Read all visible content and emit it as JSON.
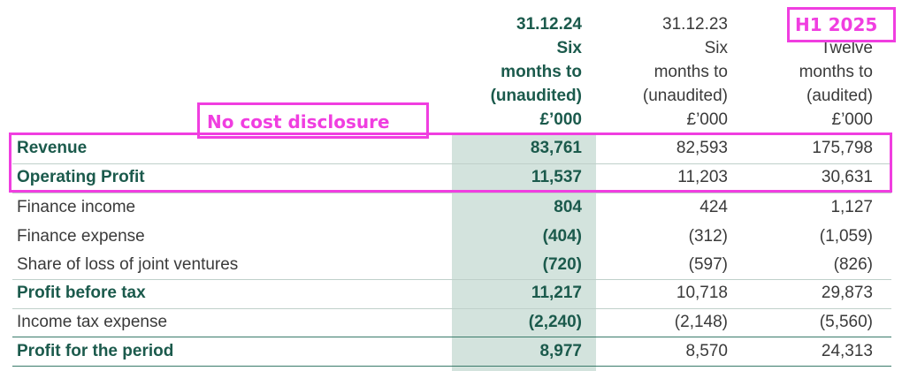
{
  "columns": [
    {
      "line1": "31.12.24",
      "line2": "Six",
      "line3": "months to",
      "line4": "(unaudited)",
      "line5": "£’000"
    },
    {
      "line1": "31.12.23",
      "line2": "Six",
      "line3": "months to",
      "line4": "(unaudited)",
      "line5": "£’000"
    },
    {
      "line1": "",
      "line2": "Twelve",
      "line3": "months to",
      "line4": "(audited)",
      "line5": "£’000"
    }
  ],
  "rows": [
    {
      "label": "Revenue",
      "v1": "83,761",
      "v2": "82,593",
      "v3": "175,798"
    },
    {
      "label": "Operating Profit",
      "v1": "11,537",
      "v2": "11,203",
      "v3": "30,631"
    },
    {
      "label": "Finance income",
      "v1": "804",
      "v2": "424",
      "v3": "1,127"
    },
    {
      "label": "Finance expense",
      "v1": "(404)",
      "v2": "(312)",
      "v3": "(1,059)"
    },
    {
      "label": "Share of loss of joint ventures",
      "v1": "(720)",
      "v2": "(597)",
      "v3": "(826)"
    },
    {
      "label": "Profit before tax",
      "v1": "11,217",
      "v2": "10,718",
      "v3": "29,873"
    },
    {
      "label": "Income tax expense",
      "v1": "(2,240)",
      "v2": "(2,148)",
      "v3": "(5,560)"
    },
    {
      "label": "Profit for the period",
      "v1": "8,977",
      "v2": "8,570",
      "v3": "24,313"
    }
  ],
  "annotations": {
    "period_tag": "H1 2025",
    "cost_note": "No cost disclosure"
  },
  "colors": {
    "accent_green": "#1b5a4c",
    "shade": "#d3e3dd",
    "annotation_magenta": "#f03ee0"
  }
}
